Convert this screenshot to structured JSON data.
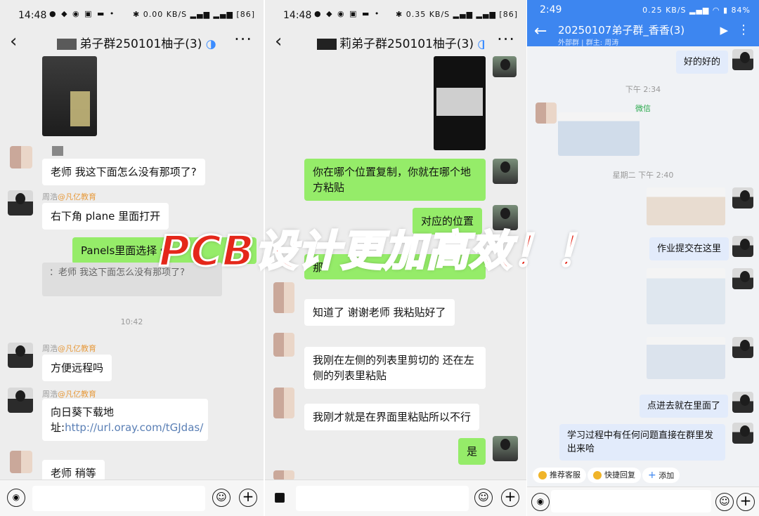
{
  "panel1": {
    "time": "14:48",
    "net": "0.00 KB/S",
    "battery": "86",
    "title": "弟子群250101柚子(3)",
    "messages": [
      {
        "sender": "",
        "text": "老师 我这下面怎么没有那项了?"
      },
      {
        "sender": "周浩@凡亿教育",
        "text": "右下角 plane 里面打开"
      },
      {
        "sender": "",
        "text": "Panels里面选择 s"
      },
      {
        "sender": "",
        "text": "：老师 我这下面怎么没有那项了?"
      },
      {
        "sender": "周浩@凡亿教育",
        "text": "方便远程吗"
      },
      {
        "sender": "周浩@凡亿教育",
        "text": "向日葵下载地址:http://url.oray.com/tGJdas/"
      },
      {
        "sender": "",
        "text": "老师 稍等"
      }
    ],
    "time_divider": "10:42",
    "sender_name": "周浩",
    "sender_org": "@凡亿教育",
    "link_prefix": "向日葵下载地址:",
    "link": "http://url.oray.com/tGJdas/"
  },
  "panel2": {
    "time": "14:48",
    "net": "0.35 KB/S",
    "battery": "86",
    "title": "莉弟子群250101柚子(3)",
    "messages": [
      {
        "text": "你在哪个位置复制，你就在哪个地方粘贴"
      },
      {
        "text": "对应的位置"
      },
      {
        "text": "知道了 谢谢老师 我粘贴好了"
      },
      {
        "text": "我刚在左侧的列表里剪切的 还在左侧的列表里粘贴"
      },
      {
        "text": "我刚才就是在界面里粘贴所以不行"
      },
      {
        "text": "是"
      }
    ],
    "partial": "那"
  },
  "panel3": {
    "time": "2:49",
    "net": "0.25 KB/S",
    "battery": "84%",
    "title": "20250107弟子群_香香(3)",
    "subtitle": "群主: 周涛",
    "subtitle_left": "外部群",
    "messages": [
      {
        "text": "好的好的"
      },
      {
        "text": "作业提交在这里"
      },
      {
        "text": "点进去就在里面了"
      },
      {
        "text": "学习过程中有任何问题直接在群里发出来哈"
      }
    ],
    "time1": "下午 2:34",
    "time2": "星期二 下午 2:40",
    "weixin_label": "微信",
    "chips": [
      "推荐客服",
      "快捷回复",
      "添加"
    ]
  },
  "overlay_text": "PCB设计更加高效！！"
}
